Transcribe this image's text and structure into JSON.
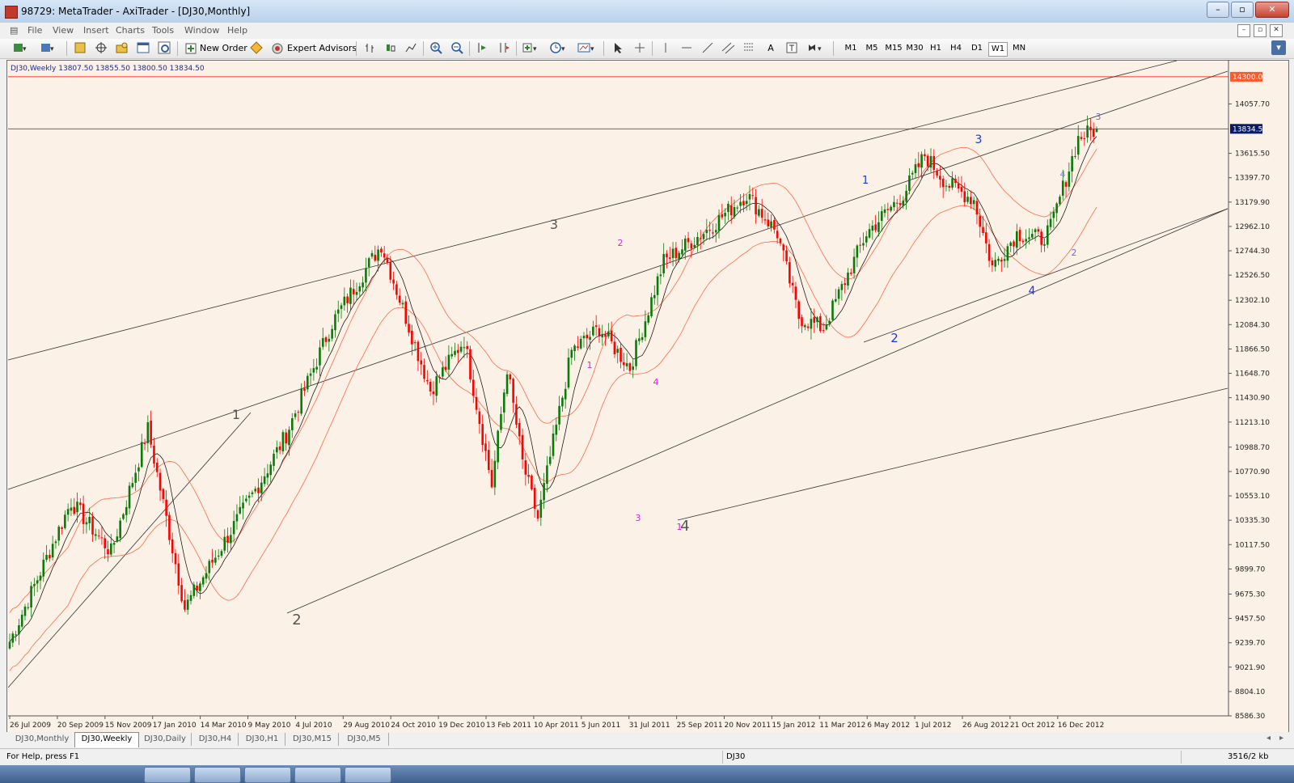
{
  "window": {
    "title": "98729: MetaTrader - AxiTrader - [DJ30,Monthly]"
  },
  "menu": [
    "File",
    "View",
    "Insert",
    "Charts",
    "Tools",
    "Window",
    "Help"
  ],
  "toolbar": {
    "new_order": "New Order",
    "expert_advisors": "Expert Advisors",
    "text_tool": "A"
  },
  "timeframes": [
    "M1",
    "M5",
    "M15",
    "M30",
    "H1",
    "H4",
    "D1",
    "W1",
    "MN"
  ],
  "active_timeframe": "W1",
  "chart": {
    "symbol_info": "DJ30,Weekly  13807.50 13855.50 13800.50 13834.50"
  },
  "chart_data": {
    "type": "candlestick",
    "symbol": "DJ30",
    "timeframe": "Weekly",
    "ohlc_last": {
      "open": 13807.5,
      "high": 13855.5,
      "low": 13800.5,
      "close": 13834.5
    },
    "price_axis": [
      "14057.70",
      "13834.5",
      "13615.50",
      "13397.70",
      "13179.90",
      "12962.10",
      "12744.30",
      "12526.50",
      "12302.10",
      "12084.30",
      "11866.50",
      "11648.70",
      "11430.90",
      "11213.10",
      "10988.70",
      "10770.90",
      "10553.10",
      "10335.30",
      "10117.50",
      "9899.70",
      "9675.30",
      "9457.50",
      "9239.70",
      "9021.90",
      "8804.10",
      "8586.30"
    ],
    "price_tags": {
      "upper": "14300.0",
      "current": "13834.5"
    },
    "price_range": [
      8586.3,
      14450
    ],
    "date_axis": [
      "26 Jul 2009",
      "20 Sep 2009",
      "15 Nov 2009",
      "17 Jan 2010",
      "14 Mar 2010",
      "9 May 2010",
      "4 Jul 2010",
      "29 Aug 2010",
      "24 Oct 2010",
      "19 Dec 2010",
      "13 Feb 2011",
      "10 Apr 2011",
      "5 Jun 2011",
      "31 Jul 2011",
      "25 Sep 2011",
      "20 Nov 2011",
      "15 Jan 2012",
      "11 Mar 2012",
      "6 May 2012",
      "1 Jul 2012",
      "26 Aug 2012",
      "21 Oct 2012",
      "16 Dec 2012"
    ],
    "wave_labels": [
      "1",
      "2",
      "3",
      "4",
      "1",
      "2",
      "3",
      "4",
      "1",
      "2",
      "3",
      "4",
      "1",
      "2",
      "3",
      "4",
      "5",
      "2",
      "3",
      "1",
      "2",
      "3"
    ],
    "colors": {
      "bull": "#0a7a0a",
      "bear": "#ff0000",
      "background": "#fbf1e6",
      "bands": "#ff6a4a",
      "ma": "#000000",
      "wave_major": "#555555",
      "wave_blue": "#1a3ccc",
      "wave_magenta": "#dd22dd"
    }
  },
  "tabs": [
    "DJ30,Monthly",
    "DJ30,Weekly",
    "DJ30,Daily",
    "DJ30,H4",
    "DJ30,H1",
    "DJ30,M15",
    "DJ30,M5"
  ],
  "active_tab": "DJ30,Weekly",
  "status": {
    "help": "For Help, press F1",
    "symbol": "DJ30",
    "traffic": "3516/2 kb"
  }
}
